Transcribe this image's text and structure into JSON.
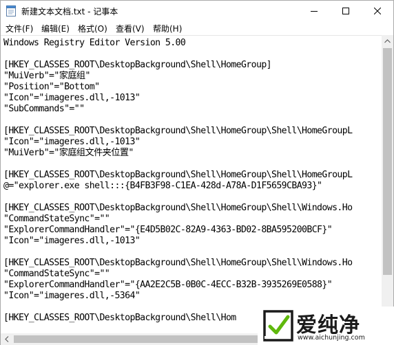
{
  "window": {
    "title": "新建文本文档.txt - 记事本"
  },
  "icons": {
    "app": "notepad-icon",
    "minimize": "minimize-icon",
    "maximize": "maximize-icon",
    "close": "close-icon",
    "scroll_up": "arrow-up-icon",
    "scroll_down": "arrow-down-icon",
    "scroll_left": "arrow-left-icon",
    "watermark_logo": "aichunjing-logo"
  },
  "menu": [
    "文件(F)",
    "编辑(E)",
    "格式(O)",
    "查看(V)",
    "帮助(H)"
  ],
  "lines": [
    "Windows Registry Editor Version 5.00",
    "",
    "[HKEY_CLASSES_ROOT\\DesktopBackground\\Shell\\HomeGroup]",
    "\"MuiVerb\"=\"家庭组\"",
    "\"Position\"=\"Bottom\"",
    "\"Icon\"=\"imageres.dll,-1013\"",
    "\"SubCommands\"=\"\"",
    "",
    "[HKEY_CLASSES_ROOT\\DesktopBackground\\Shell\\HomeGroup\\Shell\\HomeGroupL",
    "\"Icon\"=\"imageres.dll,-1013\"",
    "\"MuiVerb\"=\"家庭组文件夹位置\"",
    "",
    "[HKEY_CLASSES_ROOT\\DesktopBackground\\Shell\\HomeGroup\\Shell\\HomeGroupL",
    "@=\"explorer.exe shell:::{B4FB3F98-C1EA-428d-A78A-D1F5659CBA93}\"",
    "",
    "[HKEY_CLASSES_ROOT\\DesktopBackground\\Shell\\HomeGroup\\Shell\\Windows.Ho",
    "\"CommandStateSync\"=\"\"",
    "\"ExplorerCommandHandler\"=\"{E4D5B02C-82A9-4363-BD02-8BA595200BCF}\"",
    "\"Icon\"=\"imageres.dll,-1013\"",
    "",
    "[HKEY_CLASSES_ROOT\\DesktopBackground\\Shell\\HomeGroup\\Shell\\Windows.Ho",
    "\"CommandStateSync\"=\"\"",
    "\"ExplorerCommandHandler\"=\"{AA2E2C5B-0B0C-4ECC-B32B-3935269E0588}\"",
    "\"Icon\"=\"imageres.dll,-5364\"",
    "",
    "[HKEY_CLASSES_ROOT\\DesktopBackground\\Shell\\Hom"
  ],
  "watermark": {
    "name": "爱纯净",
    "url": "www.aichunjing.com"
  }
}
